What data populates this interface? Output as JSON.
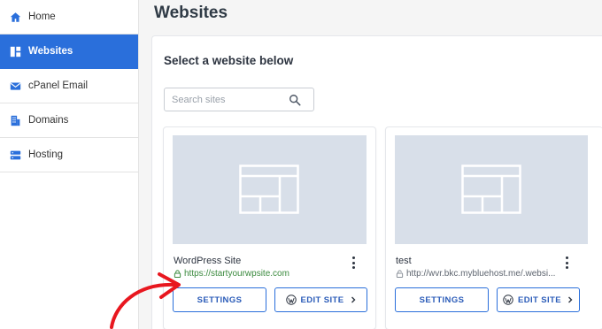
{
  "sidebar": {
    "items": [
      {
        "label": "Home",
        "icon": "home-icon",
        "active": false
      },
      {
        "label": "Websites",
        "icon": "grid-icon",
        "active": true
      },
      {
        "label": "cPanel Email",
        "icon": "mail-icon",
        "active": false
      },
      {
        "label": "Domains",
        "icon": "building-icon",
        "active": false
      },
      {
        "label": "Hosting",
        "icon": "server-icon",
        "active": false
      }
    ]
  },
  "page": {
    "title": "Websites",
    "heading": "Select a website below",
    "search_placeholder": "Search sites"
  },
  "sites": [
    {
      "name": "WordPress Site",
      "url": "https://startyourwpsite.com",
      "secure": true,
      "settings_label": "SETTINGS",
      "edit_label": "EDIT SITE"
    },
    {
      "name": "test",
      "url": "http://wvr.bkc.mybluehost.me/.websi...",
      "secure": false,
      "settings_label": "SETTINGS",
      "edit_label": "EDIT SITE"
    }
  ],
  "colors": {
    "accent": "#2a6fdb",
    "annotation_arrow": "#e8171f",
    "thumbnail_bg": "#d8dfe9"
  }
}
